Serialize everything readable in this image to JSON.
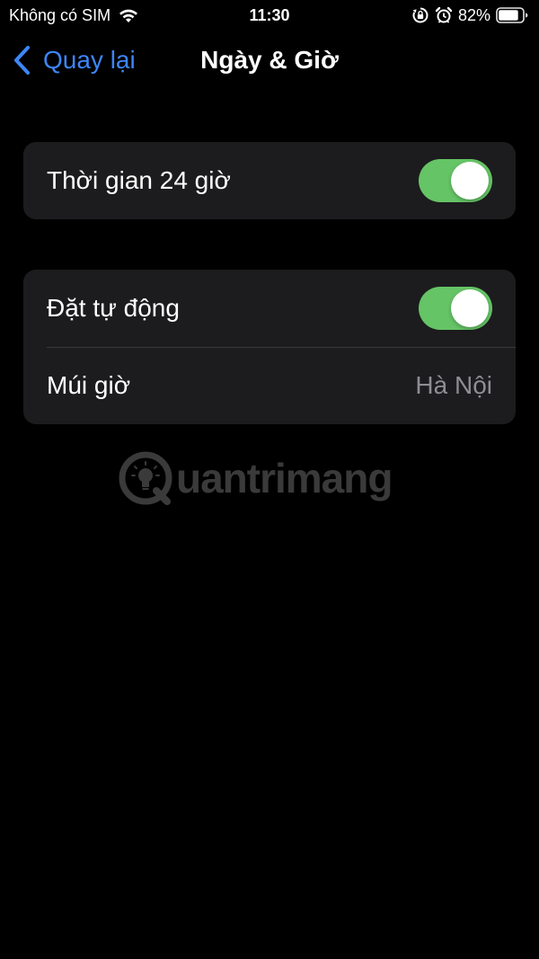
{
  "status_bar": {
    "carrier": "Không có SIM",
    "time": "11:30",
    "battery_percent": "82%",
    "icons": [
      "wifi-icon",
      "orientation-lock-icon",
      "alarm-icon",
      "battery-icon"
    ]
  },
  "nav": {
    "back_label": "Quay lại",
    "title": "Ngày & Giờ"
  },
  "settings": {
    "group1": {
      "row1": {
        "label": "Thời gian 24 giờ",
        "toggle_on": true
      }
    },
    "group2": {
      "row1": {
        "label": "Đặt tự động",
        "toggle_on": true
      },
      "row2": {
        "label": "Múi giờ",
        "value": "Hà Nội"
      }
    }
  },
  "watermark": {
    "text": "uantrimang"
  },
  "colors": {
    "background": "#000000",
    "cell": "#1c1c1e",
    "accent_blue": "#3d86f7",
    "toggle_green": "#65c466",
    "secondary_text": "#8d8d93"
  }
}
